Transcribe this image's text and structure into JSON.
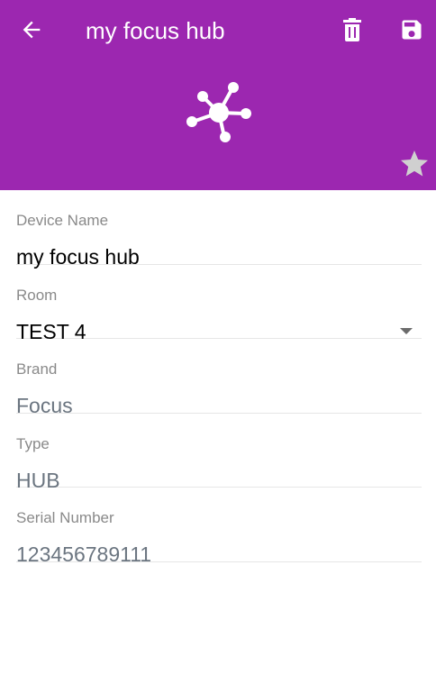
{
  "colors": {
    "header_bg": "#9c27b0",
    "label": "#8a8a8a",
    "readonly_value": "#6b7580",
    "divider": "#e6e6e6"
  },
  "toolbar": {
    "title": "my focus hub",
    "back_icon": "arrow-left-icon",
    "delete_icon": "trash-icon",
    "save_icon": "floppy-disk-icon"
  },
  "header": {
    "device_icon": "hub-network-icon",
    "favorite_icon": "star-icon"
  },
  "form": {
    "device_name": {
      "label": "Device Name",
      "value": "my focus hub"
    },
    "room": {
      "label": "Room",
      "value": "TEST 4"
    },
    "brand": {
      "label": "Brand",
      "value": "Focus"
    },
    "type": {
      "label": "Type",
      "value": "HUB"
    },
    "serial": {
      "label": "Serial Number",
      "value": "123456789111"
    }
  }
}
